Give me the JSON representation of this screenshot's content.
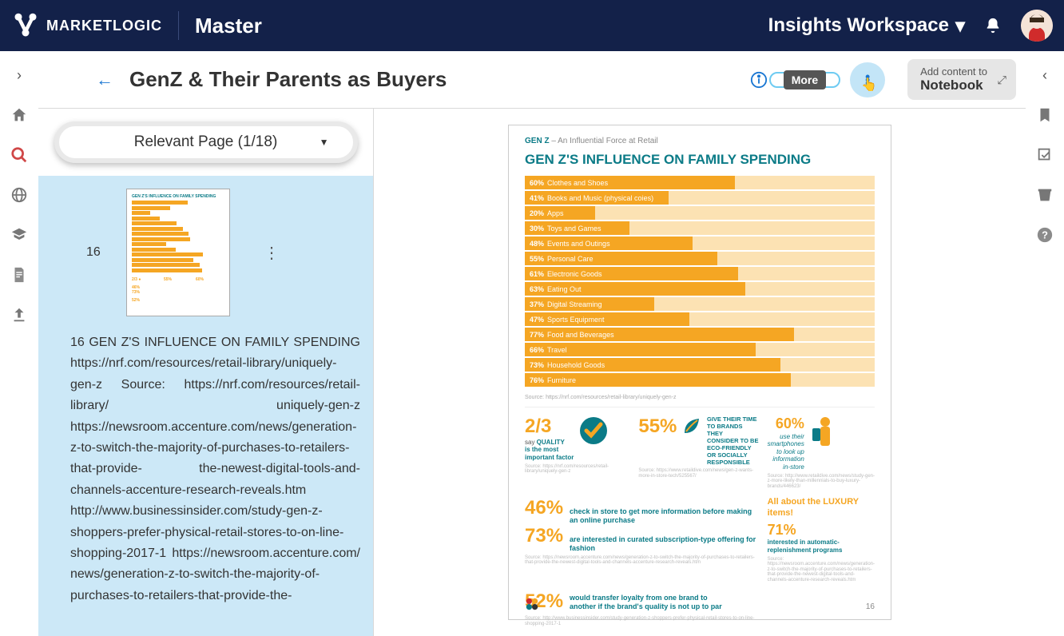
{
  "topbar": {
    "logo": "MARKETLOGIC",
    "master": "Master",
    "workspace": "Insights Workspace"
  },
  "header": {
    "title": "GenZ & Their Parents as Buyers",
    "more": "More",
    "addContentLine1": "Add content to",
    "addContentLine2": "Notebook"
  },
  "leftPanel": {
    "relevantPage": "Relevant Page (1/18)",
    "thumbNumber": "16",
    "excerpt": "16 GEN Z'S INFLUENCE ON FAMILY SPENDING https://nrf.com/resources/retail-library/uniquely-gen-z Source: https://nrf.com/resources/retail-library/ uniquely-gen-z https://newsroom.accenture.com/news/generation-z-to-switch-the-majority-of-purchases-to-retailers-that-provide- the-newest-digital-tools-and-channels-accenture-research-reveals.htm http://www.businessinsider.com/study-gen-z-shoppers-prefer-physical-retail-stores-to-on-line-shopping-2017-1 https://newsroom.accenture.com/ news/generation-z-to-switch-the-majority-of-purchases-to-retailers-that-provide-the-"
  },
  "doc": {
    "eyebrow_bold": "GEN Z",
    "eyebrow_rest": " – An Influential Force at Retail",
    "title": "GEN Z'S INFLUENCE ON FAMILY SPENDING",
    "source_line": "Source: https://nrf.com/resources/retail-library/uniquely-gen-z",
    "page_number": "16"
  },
  "chart_data": {
    "type": "bar",
    "orientation": "horizontal",
    "title": "GEN Z'S INFLUENCE ON FAMILY SPENDING",
    "xlabel": "",
    "ylabel": "",
    "ylim": [
      0,
      100
    ],
    "categories": [
      "Clothes and Shoes",
      "Books and Music (physical coies)",
      "Apps",
      "Toys and Games",
      "Events and Outings",
      "Personal Care",
      "Electronic Goods",
      "Eating Out",
      "Digital Streaming",
      "Sports Equipment",
      "Food and Beverages",
      "Travel",
      "Household Goods",
      "Furniture"
    ],
    "values": [
      60,
      41,
      20,
      30,
      48,
      55,
      61,
      63,
      37,
      47,
      77,
      66,
      73,
      76
    ]
  },
  "stats": {
    "two_thirds": {
      "big": "2/3",
      "l1": "say ",
      "l1b": "QUALITY",
      "l2": "is the most",
      "l3": "important factor",
      "src": "Source: https://nrf.com/resources/retail-library/uniquely-gen-z"
    },
    "fiftyfive": {
      "big": "55%",
      "l1": "GIVE THEIR TIME",
      "l2": "TO BRANDS THEY",
      "l3": "CONSIDER TO BE",
      "l4": "ECO-FRIENDLY",
      "l5": "OR SOCIALLY",
      "l6": "RESPONSIBLE",
      "src": "Source: https://www.retaildive.com/news/gen-z-wants-more-in-store-tech/525567/"
    },
    "sixty": {
      "big": "60%",
      "l1": "use their",
      "l2": "smartphones",
      "l3": "to look up",
      "l4": "information",
      "l5": "in-store",
      "src": "Source: http://www.retaildive.com/news/study-gen-z-more-likely-than-millennials-to-buy-luxury-brands/446623/"
    },
    "fortysix": {
      "big": "46%",
      "txt": "check in store to get more information before making an online purchase"
    },
    "seventythree": {
      "big": "73%",
      "txt": "are interested in curated subscription-type offering for fashion",
      "src": "Source: https://newsroom.accenture.com/news/generation-z-to-switch-the-majority-of-purchases-to-retailers-that-provide-the-newest-digital-tools-and-channels-accenture-research-reveals.htm"
    },
    "lux": {
      "title": "All about the LUXURY items!"
    },
    "seventyone": {
      "big": "71%",
      "l1": "interested in automatic-",
      "l2": "replenishment programs",
      "src": "Source: https://newsroom.accenture.com/news/generation-z-to-switch-the-majority-of-purchases-to-retailers-that-provide-the-newest-digital-tools-and-channels-accenture-research-reveals.htm"
    },
    "fiftytwo": {
      "big": "52%",
      "l1": "would transfer loyalty from one brand to",
      "l2": "another if the brand's quality is not up to par",
      "src": "Source: http://www.businessinsider.com/study-generation-z-shoppers-prefer-physical-retail-stores-to-on-line-shopping-2017-1"
    }
  }
}
